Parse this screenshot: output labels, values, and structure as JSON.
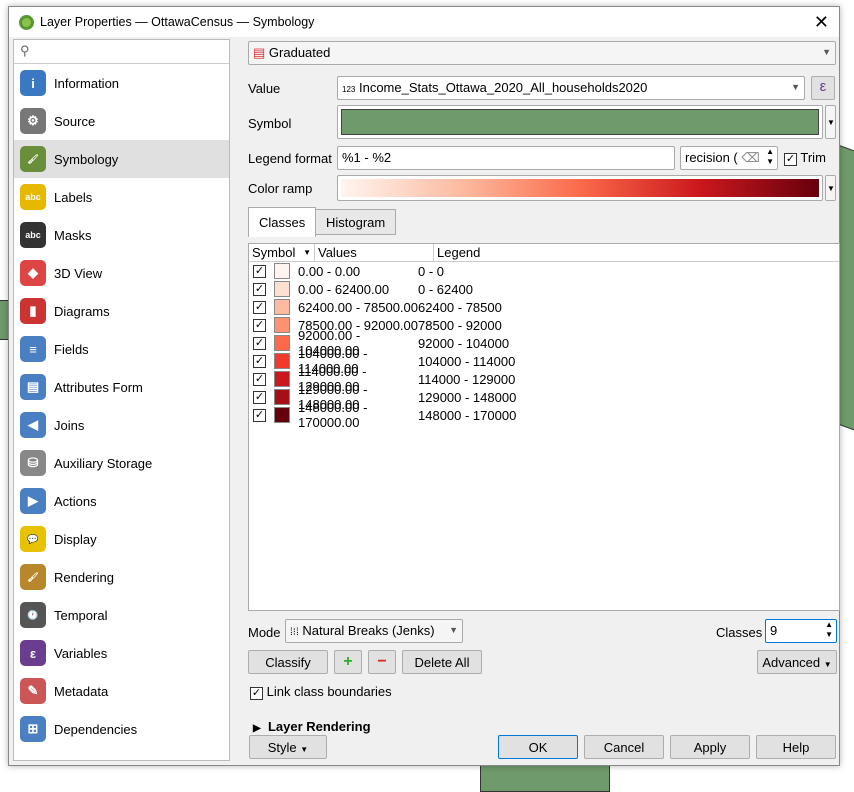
{
  "window": {
    "title": "Layer Properties — OttawaCensus — Symbology",
    "close": "✕"
  },
  "sidebar": {
    "items": [
      {
        "label": "Information",
        "color": "#3a78c2",
        "glyph": "i"
      },
      {
        "label": "Source",
        "color": "#777",
        "glyph": "⚙"
      },
      {
        "label": "Symbology",
        "color": "#6a8f3a",
        "glyph": "🖌"
      },
      {
        "label": "Labels",
        "color": "#e6b800",
        "glyph": "abc"
      },
      {
        "label": "Masks",
        "color": "#333",
        "glyph": "abc"
      },
      {
        "label": "3D View",
        "color": "#d44",
        "glyph": "◆"
      },
      {
        "label": "Diagrams",
        "color": "#c33",
        "glyph": "▮"
      },
      {
        "label": "Fields",
        "color": "#4a7fc1",
        "glyph": "≡"
      },
      {
        "label": "Attributes Form",
        "color": "#4a7fc1",
        "glyph": "▤"
      },
      {
        "label": "Joins",
        "color": "#4a7fc1",
        "glyph": "◀"
      },
      {
        "label": "Auxiliary Storage",
        "color": "#888",
        "glyph": "⛁"
      },
      {
        "label": "Actions",
        "color": "#4a7fc1",
        "glyph": "▶"
      },
      {
        "label": "Display",
        "color": "#e6c200",
        "glyph": "💬"
      },
      {
        "label": "Rendering",
        "color": "#b8862b",
        "glyph": "🖌"
      },
      {
        "label": "Temporal",
        "color": "#555",
        "glyph": "🕐"
      },
      {
        "label": "Variables",
        "color": "#6a3d8f",
        "glyph": "ε"
      },
      {
        "label": "Metadata",
        "color": "#c55",
        "glyph": "✎"
      },
      {
        "label": "Dependencies",
        "color": "#4a7fc1",
        "glyph": "⊞"
      }
    ],
    "selected": "Symbology"
  },
  "renderer": "Graduated",
  "value": {
    "label": "Value",
    "type": "123",
    "field": "Income_Stats_Ottawa_2020_All_households2020",
    "expr": "ε"
  },
  "symbol": {
    "label": "Symbol",
    "color": "#6f9a6c"
  },
  "legend_format": {
    "label": "Legend format",
    "value": "%1 - %2",
    "precision": "recision (",
    "trim_label": "Trim",
    "trim": true
  },
  "color_ramp": {
    "label": "Color ramp",
    "colors": [
      "#fff5f0",
      "#fcbba1",
      "#fb6a4a",
      "#cb181d",
      "#67000d"
    ]
  },
  "tabs": [
    "Classes",
    "Histogram"
  ],
  "table": {
    "headers": [
      "Symbol",
      "Values",
      "Legend"
    ],
    "rows": [
      {
        "color": "#fff5f0",
        "values": "0.00 - 0.00",
        "legend": "0 - 0"
      },
      {
        "color": "#fee0d2",
        "values": "0.00 - 62400.00",
        "legend": "0 - 62400"
      },
      {
        "color": "#fcbba1",
        "values": "62400.00 - 78500.00",
        "legend": "62400 - 78500"
      },
      {
        "color": "#fc9272",
        "values": "78500.00 - 92000.00",
        "legend": "78500 - 92000"
      },
      {
        "color": "#fb6a4a",
        "values": "92000.00 - 104000.00",
        "legend": "92000 - 104000"
      },
      {
        "color": "#ef3b2c",
        "values": "104000.00 - 114000.00",
        "legend": "104000 - 114000"
      },
      {
        "color": "#cb181d",
        "values": "114000.00 - 129000.00",
        "legend": "114000 - 129000"
      },
      {
        "color": "#a50f15",
        "values": "129000.00 - 148000.00",
        "legend": "129000 - 148000"
      },
      {
        "color": "#67000d",
        "values": "148000.00 - 170000.00",
        "legend": "148000 - 170000"
      }
    ]
  },
  "mode": {
    "label": "Mode",
    "value": "Natural Breaks (Jenks)"
  },
  "classes": {
    "label": "Classes",
    "value": "9"
  },
  "buttons": {
    "classify": "Classify",
    "add": "+",
    "remove": "−",
    "delete_all": "Delete All",
    "advanced": "Advanced",
    "style": "Style",
    "ok": "OK",
    "cancel": "Cancel",
    "apply": "Apply",
    "help": "Help"
  },
  "link_boundaries": "Link class boundaries",
  "layer_rendering": "Layer Rendering"
}
